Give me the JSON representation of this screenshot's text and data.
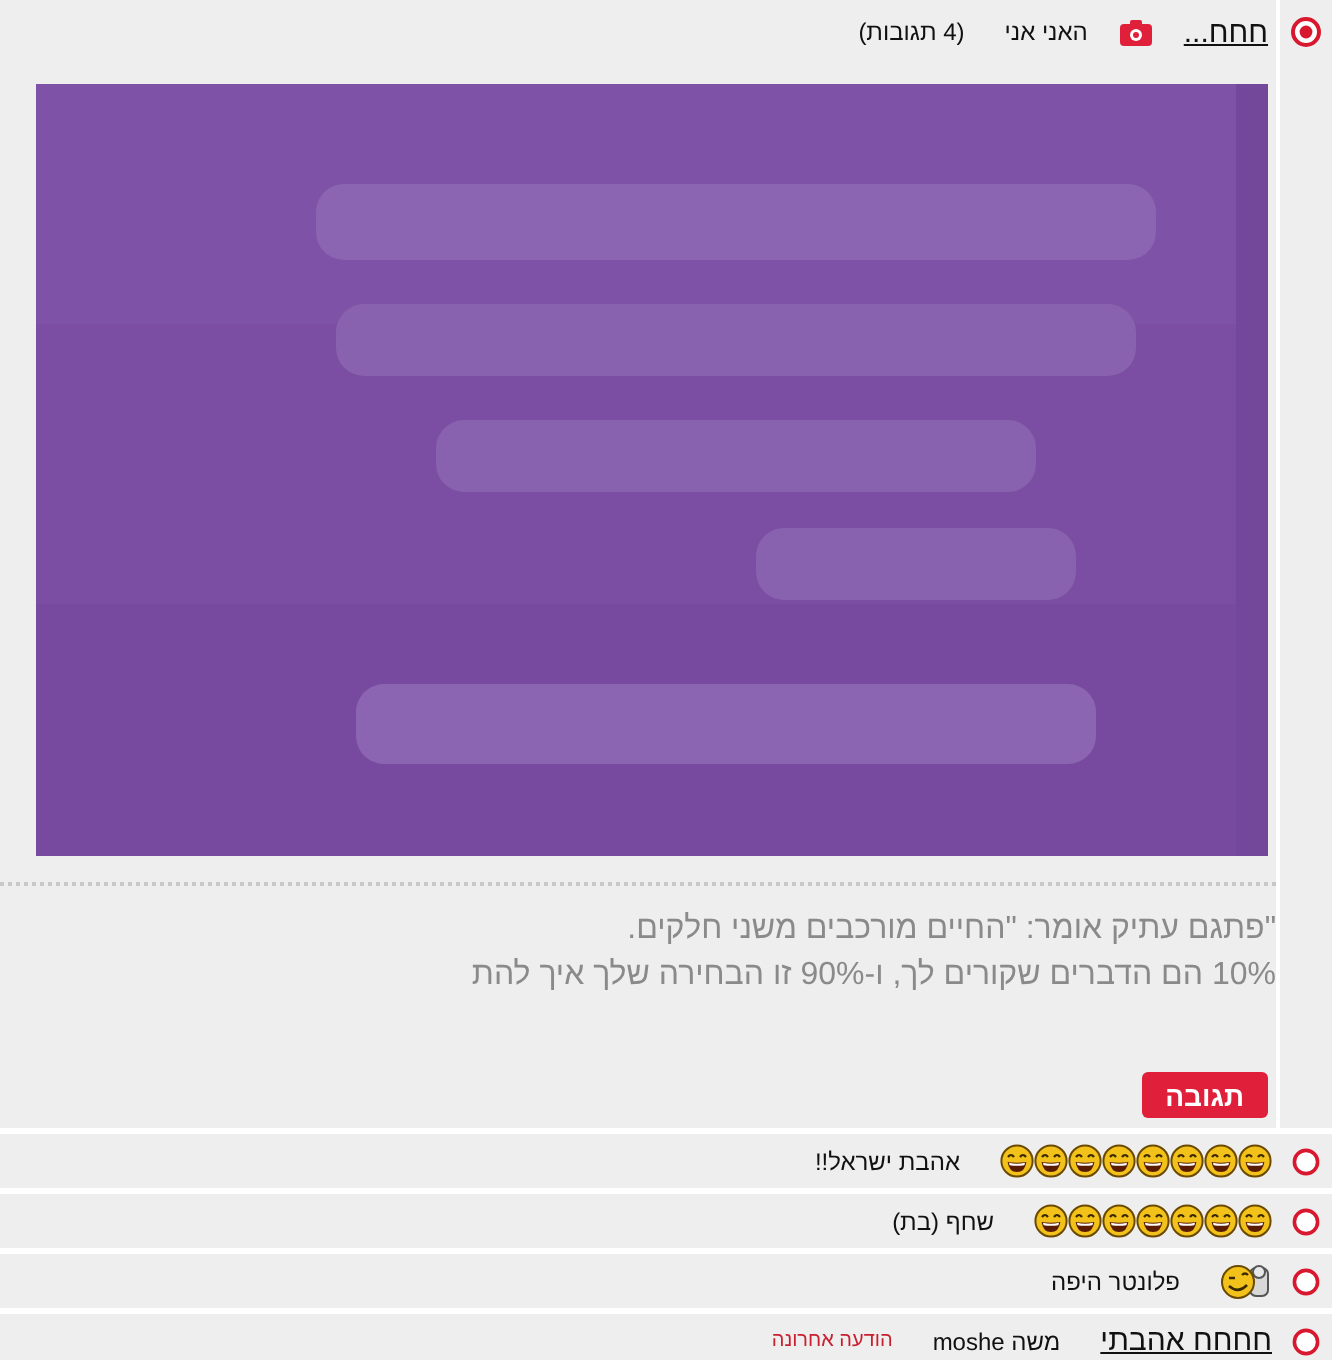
{
  "post": {
    "selected": true,
    "title": "חחח...",
    "author": "האני אני",
    "replies_count": "(4 תגובות)",
    "quote_lines": [
      "\"פתגם עתיק אומר: \"החיים מורכבים משני חלקים.",
      "10% הם הדברים שקורים לך, ו-90% זו הבחירה שלך איך להת"
    ]
  },
  "reply_button": "תגובה",
  "replies": [
    {
      "selected": false,
      "emoticons": [
        {
          "kind": "laugh"
        },
        {
          "kind": "laugh"
        },
        {
          "kind": "laugh"
        },
        {
          "kind": "laugh"
        },
        {
          "kind": "laugh"
        },
        {
          "kind": "laugh"
        },
        {
          "kind": "laugh"
        },
        {
          "kind": "laugh"
        }
      ],
      "author": "אהבת ישראל!!"
    },
    {
      "selected": false,
      "emoticons": [
        {
          "kind": "laugh"
        },
        {
          "kind": "laugh"
        },
        {
          "kind": "laugh"
        },
        {
          "kind": "laugh"
        },
        {
          "kind": "laugh"
        },
        {
          "kind": "laugh"
        },
        {
          "kind": "laugh"
        }
      ],
      "author": "שחף (בת)"
    },
    {
      "selected": false,
      "emoticons": [
        {
          "kind": "wink"
        }
      ],
      "author": "פלונטר היפה"
    },
    {
      "selected": false,
      "title": "חחחח אהבתי",
      "author": "משה moshe",
      "last_message": "הודעה אחרונה"
    }
  ]
}
